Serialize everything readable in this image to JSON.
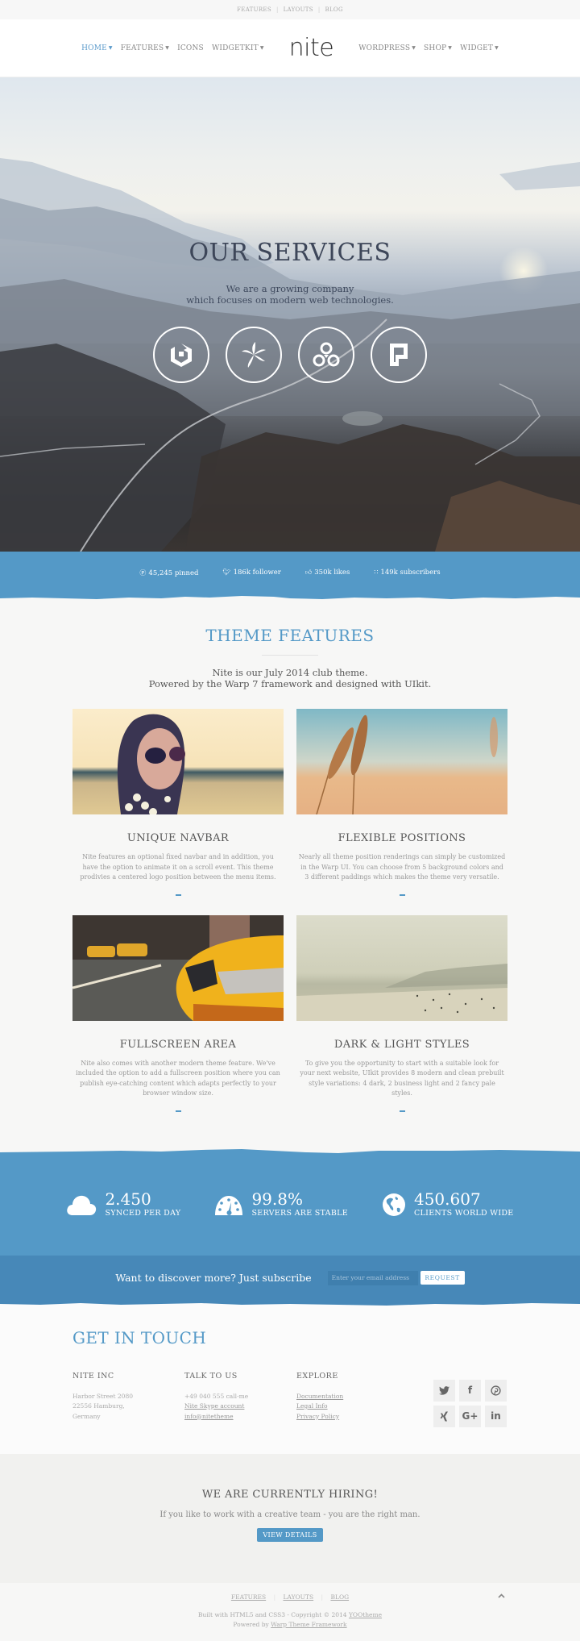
{
  "toolbar": {
    "links": [
      "FEATURES",
      "LAYOUTS",
      "BLOG"
    ]
  },
  "navbar": {
    "logo": "nite",
    "left_items": [
      {
        "label": "HOME",
        "has_dropdown": true,
        "active": true
      },
      {
        "label": "FEATURES",
        "has_dropdown": true
      },
      {
        "label": "ICONS",
        "has_dropdown": false
      },
      {
        "label": "WIDGETKIT",
        "has_dropdown": true
      }
    ],
    "right_items": [
      {
        "label": "WORDPRESS",
        "has_dropdown": true
      },
      {
        "label": "SHOP",
        "has_dropdown": true
      },
      {
        "label": "WIDGET",
        "has_dropdown": true
      }
    ]
  },
  "hero": {
    "title": "OUR SERVICES",
    "subtitle_line1": "We are a growing company",
    "subtitle_line2": "which focuses on modern web technologies.",
    "icons": [
      "uikit-icon",
      "bamboo-leaf-icon",
      "joomla-rings-icon",
      "paper-page-icon"
    ]
  },
  "social_bar": {
    "stats": [
      {
        "icon": "pinterest-icon",
        "glyph": "Ⓟ",
        "text": "45,245 pinned"
      },
      {
        "icon": "twitter-icon",
        "glyph": "✉",
        "text": "186k follower"
      },
      {
        "icon": "thumbs-up-icon",
        "glyph": "☝",
        "text": "350k likes"
      },
      {
        "icon": "rss-icon",
        "glyph": "≡",
        "text": "149k subscribers"
      }
    ]
  },
  "features": {
    "title": "THEME FEATURES",
    "subtitle_line1": "Nite is our July 2014 club theme.",
    "subtitle_line2": "Powered by the Warp 7 framework and designed with UIkit.",
    "cards": [
      {
        "title": "UNIQUE NAVBAR",
        "text": "Nite features an optional fixed navbar and in addition, you have the option to animate it on a scroll event. This theme prodivies a centered logo position between the menu items.",
        "image": "woman-sunglasses-photo"
      },
      {
        "title": "FLEXIBLE POSITIONS",
        "text": "Nearly all theme position renderings can simply be customized in the Warp UI. You can choose from 5 background colors and 3 different paddings which makes the theme very versatile.",
        "image": "wheat-field-photo"
      },
      {
        "title": "FULLSCREEN AREA",
        "text": "Nite also comes with another modern theme feature. We've included the option to add a fullscreen position where you can publish eye-catching content which adapts perfectly to your browser window size.",
        "image": "yellow-taxi-photo"
      },
      {
        "title": "DARK & LIGHT STYLES",
        "text": "To give you the opportunity to start with a suitable look for your next website, UIkit provides 8 modern and clean prebuilt style variations: 4 dark, 2 business light and 2 fancy pale styles.",
        "image": "foggy-beach-photo"
      }
    ]
  },
  "stats": [
    {
      "icon": "cloud-icon",
      "number": "2.450",
      "label": "SYNCED PER DAY"
    },
    {
      "icon": "dashboard-gauge-icon",
      "number": "99.8%",
      "label": "SERVERS ARE STABLE"
    },
    {
      "icon": "globe-icon",
      "number": "450.607",
      "label": "CLIENTS WORLD WIDE"
    }
  ],
  "subscribe": {
    "text": "Want to discover more? Just subscribe",
    "placeholder": "Enter your email address",
    "button": "REQUEST"
  },
  "contact": {
    "title": "GET IN TOUCH",
    "columns": [
      {
        "title": "NITE INC",
        "lines": [
          {
            "text": "Harbor Street 2080",
            "link": false
          },
          {
            "text": "22556 Hamburg,",
            "link": false
          },
          {
            "text": "Germany",
            "link": false
          }
        ]
      },
      {
        "title": "TALK TO US",
        "lines": [
          {
            "text": "+49 040 555 call-me",
            "link": false
          },
          {
            "text": "Nite Skype account",
            "link": true
          },
          {
            "text": "info@nitetheme",
            "link": true
          }
        ]
      },
      {
        "title": "EXPLORE",
        "lines": [
          {
            "text": "Documentation",
            "link": true
          },
          {
            "text": "Legal Info",
            "link": true
          },
          {
            "text": "Privacy Policy",
            "link": true
          }
        ]
      }
    ],
    "socials": [
      {
        "name": "twitter-icon",
        "glyph": "t"
      },
      {
        "name": "facebook-icon",
        "glyph": "f"
      },
      {
        "name": "pinterest-icon",
        "glyph": "p"
      },
      {
        "name": "xing-icon",
        "glyph": "x"
      },
      {
        "name": "google-plus-icon",
        "glyph": "G+"
      },
      {
        "name": "linkedin-icon",
        "glyph": "in"
      }
    ]
  },
  "hiring": {
    "title": "WE ARE CURRENTLY HIRING!",
    "subtitle": "If you like to work with a creative team - you are the right man.",
    "button": "VIEW DETAILS"
  },
  "footer": {
    "links": [
      "FEATURES",
      "LAYOUTS",
      "BLOG"
    ],
    "copy_prefix": "Built with HTML5 and CSS3 - Copyright © 2014 ",
    "copy_link": "YOOtheme",
    "powered_prefix": "Powered by ",
    "powered_link": "Warp Theme Framework",
    "to_top": "^"
  },
  "colors": {
    "accent": "#5499c7",
    "accent_dark": "#4788b8",
    "text": "#555555",
    "muted": "#999999"
  }
}
